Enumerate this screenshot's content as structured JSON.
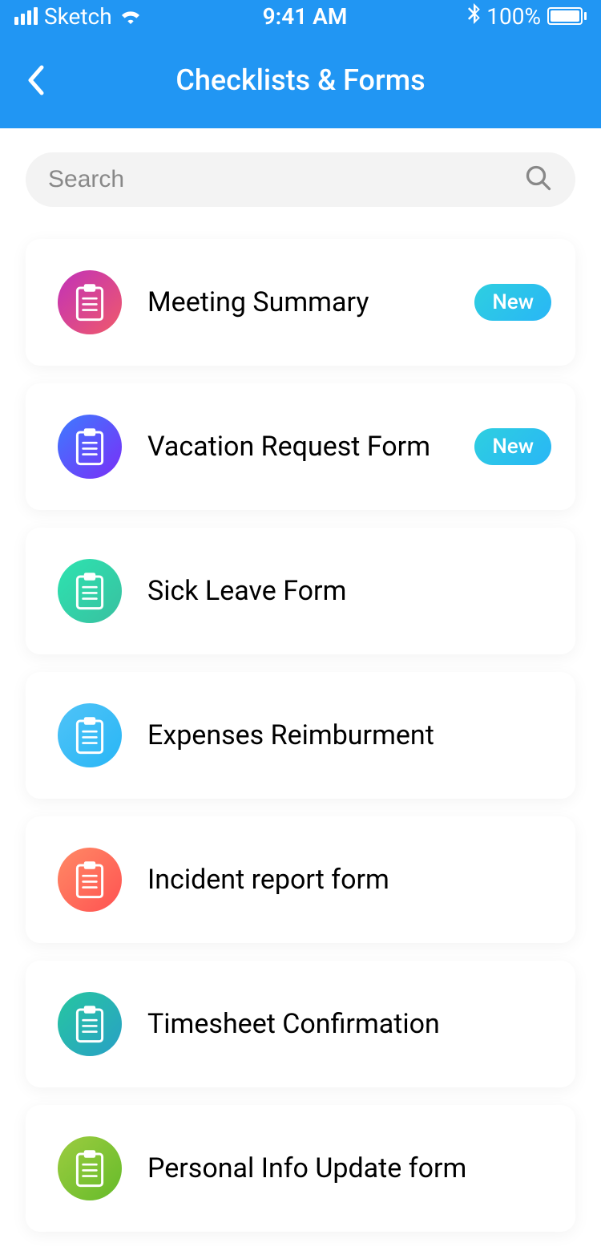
{
  "statusBar": {
    "carrier": "Sketch",
    "time": "9:41 AM",
    "batteryPercent": "100%"
  },
  "header": {
    "title": "Checklists & Forms"
  },
  "search": {
    "placeholder": "Search"
  },
  "badgeLabel": "New",
  "items": [
    {
      "title": "Meeting Summary",
      "gradient": "grad-pink",
      "badge": true
    },
    {
      "title": "Vacation Request Form",
      "gradient": "grad-blue",
      "badge": true
    },
    {
      "title": "Sick Leave Form",
      "gradient": "grad-teal",
      "badge": false
    },
    {
      "title": "Expenses Reimburment",
      "gradient": "grad-cyan",
      "badge": false
    },
    {
      "title": "Incident report form",
      "gradient": "grad-orange",
      "badge": false
    },
    {
      "title": "Timesheet Confirmation",
      "gradient": "grad-tealblue",
      "badge": false
    },
    {
      "title": "Personal Info Update form",
      "gradient": "grad-green",
      "badge": false
    }
  ]
}
